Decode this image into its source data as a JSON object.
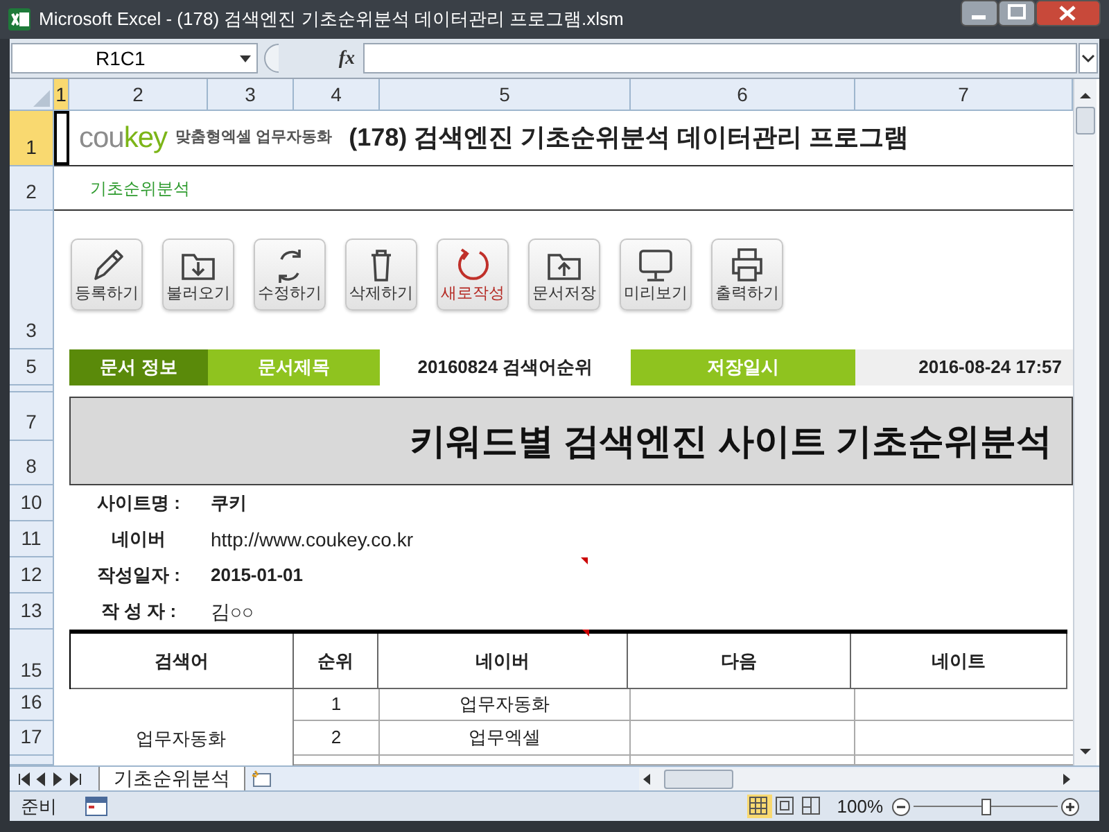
{
  "window": {
    "title": "Microsoft Excel - (178) 검색엔진 기초순위분석 데이터관리 프로그램.xlsm"
  },
  "formula_bar": {
    "name_box": "R1C1",
    "fx": "fx"
  },
  "column_headers": [
    {
      "label": "1",
      "selected": true
    },
    {
      "label": "2",
      "selected": false
    },
    {
      "label": "3",
      "selected": false
    },
    {
      "label": "4",
      "selected": false
    },
    {
      "label": "5",
      "selected": false
    },
    {
      "label": "6",
      "selected": false
    },
    {
      "label": "7",
      "selected": false
    }
  ],
  "row_headers": [
    {
      "label": "1",
      "selected": true
    },
    {
      "label": "2",
      "selected": false
    },
    {
      "label": "3",
      "selected": false
    },
    {
      "label": "5",
      "selected": false
    },
    {
      "label": "7",
      "selected": false
    },
    {
      "label": "8",
      "selected": false
    },
    {
      "label": "10",
      "selected": false
    },
    {
      "label": "11",
      "selected": false
    },
    {
      "label": "12",
      "selected": false
    },
    {
      "label": "13",
      "selected": false
    },
    {
      "label": "15",
      "selected": false
    },
    {
      "label": "16",
      "selected": false
    },
    {
      "label": "17",
      "selected": false
    }
  ],
  "sheet": {
    "brand": [
      {
        "text": "cou",
        "accent": false
      },
      {
        "text": "key",
        "accent": true
      }
    ],
    "tagline": "맞춤형엑셀 업무자동화",
    "title": "(178) 검색엔진 기초순위분석 데이터관리 프로그램",
    "section": "기초순위분석",
    "toolbar": [
      {
        "kind": "pencil",
        "label": "등록하기",
        "accent": false
      },
      {
        "kind": "folder_down",
        "label": "불러오기",
        "accent": false
      },
      {
        "kind": "refresh",
        "label": "수정하기",
        "accent": false
      },
      {
        "kind": "trash",
        "label": "삭제하기",
        "accent": false
      },
      {
        "kind": "reset",
        "label": "새로작성",
        "accent": true
      },
      {
        "kind": "folder_up",
        "label": "문서저장",
        "accent": false
      },
      {
        "kind": "monitor",
        "label": "미리보기",
        "accent": false
      },
      {
        "kind": "printer",
        "label": "출력하기",
        "accent": false
      }
    ],
    "doc_info": {
      "label": "문서 정보",
      "title_label": "문서제목",
      "title_value": "20160824 검색어순위",
      "saved_label": "저장일시",
      "saved_value": "2016-08-24 17:57"
    },
    "report_title": "키워드별 검색엔진 사이트 기초순위분석",
    "fields": [
      {
        "label": "사이트명 :",
        "value": "쿠키",
        "bold": true
      },
      {
        "label": "네이버",
        "value": "http://www.coukey.co.kr",
        "bold": false
      },
      {
        "label": "작성일자 :",
        "value": "2015-01-01",
        "bold": true
      },
      {
        "label": "작 성 자 :",
        "value": "김○○",
        "bold": false
      }
    ],
    "table": {
      "columns": [
        "검색어",
        "순위",
        "네이버",
        "다음",
        "네이트"
      ],
      "groups": [
        {
          "keyword": "업무자동화",
          "rows": [
            {
              "rank": "1",
              "naver": "업무자동화"
            },
            {
              "rank": "2",
              "naver": "업무엑셀"
            }
          ]
        }
      ]
    }
  },
  "sheet_tabs": [
    {
      "label": "기초순위분석",
      "selected": true
    }
  ],
  "status_bar": {
    "mode": "준비",
    "views": [
      {
        "kind": "normal",
        "selected": true
      },
      {
        "kind": "page_layout",
        "selected": false
      },
      {
        "kind": "page_break",
        "selected": false
      }
    ],
    "zoom": "100%",
    "level": 0.5
  }
}
